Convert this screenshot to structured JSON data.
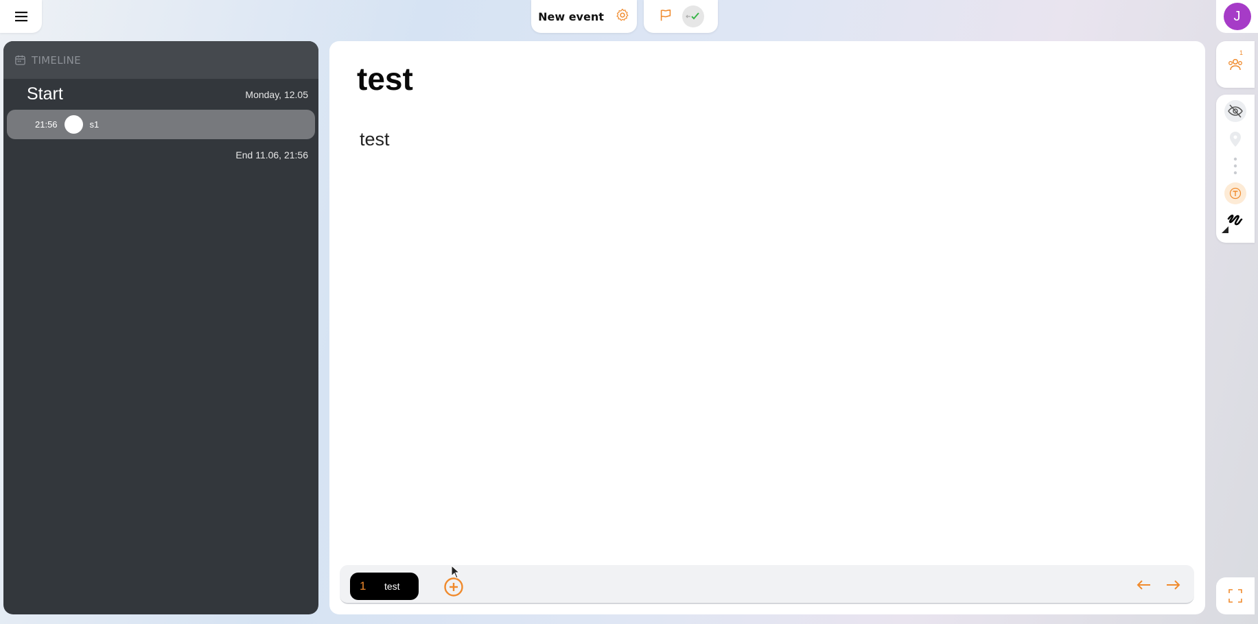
{
  "top": {
    "event_title": "New event",
    "avatar_initial": "J"
  },
  "sidebar": {
    "header": "TIMELINE",
    "start_title": "Start",
    "start_date": "Monday, 12.05",
    "steps": [
      {
        "time": "21:56",
        "label": "s1"
      }
    ],
    "end_text": "End 11.06, 21:56"
  },
  "main": {
    "title": "test",
    "body": "test"
  },
  "slides": [
    {
      "number": "1",
      "name": "test"
    }
  ],
  "rail": {
    "participants_badge": "1"
  },
  "colors": {
    "accent": "#f08a2c",
    "sidebar_bg": "#33373c",
    "avatar_bg": "#a63bc7",
    "check": "#3bb54a"
  },
  "icons": [
    "menu-icon",
    "settings-gear-icon",
    "flag-icon",
    "check-icon",
    "calendar-icon",
    "participants-icon",
    "eye-off-icon",
    "location-pin-icon",
    "more-vertical-icon",
    "text-icon",
    "draw-icon",
    "add-circle-icon",
    "arrow-left-icon",
    "arrow-right-icon",
    "fullscreen-icon"
  ]
}
